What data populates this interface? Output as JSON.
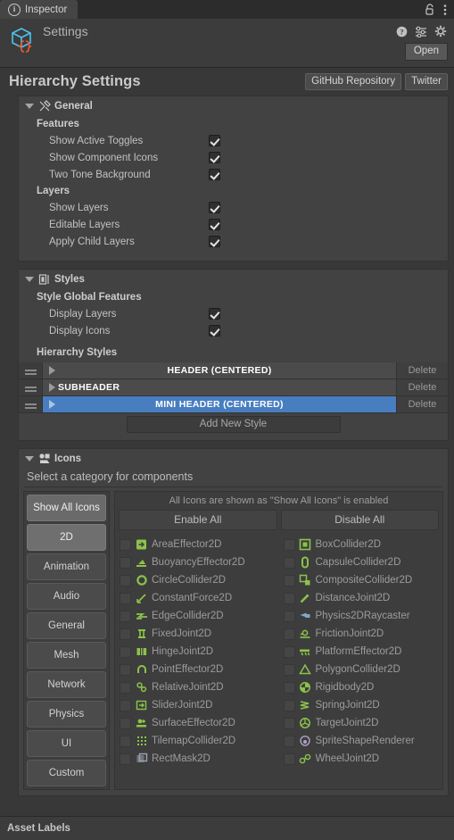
{
  "window": {
    "tab_label": "Inspector",
    "tab_icon": "info-icon",
    "lock_icon": "lock-open-icon",
    "menu_icon": "kebab-menu-icon"
  },
  "object_header": {
    "title": "Settings",
    "icon": "script-asset-cube-icon",
    "help_icon": "help-icon",
    "preset_icon": "preset-slider-icon",
    "settings_icon": "gear-icon",
    "open_button": "Open"
  },
  "page": {
    "title": "Hierarchy Settings",
    "links": [
      {
        "label": "GitHub Repository",
        "name": "github-repository-button"
      },
      {
        "label": "Twitter",
        "name": "twitter-button"
      }
    ]
  },
  "general": {
    "header": "General",
    "header_icon": "tools-icon",
    "groups": [
      {
        "label": "Features",
        "rows": [
          {
            "label": "Show Active Toggles",
            "checked": true
          },
          {
            "label": "Show Component Icons",
            "checked": true
          },
          {
            "label": "Two Tone Background",
            "checked": true
          }
        ]
      },
      {
        "label": "Layers",
        "rows": [
          {
            "label": "Show Layers",
            "checked": true
          },
          {
            "label": "Editable Layers",
            "checked": true
          },
          {
            "label": "Apply Child Layers",
            "checked": true
          }
        ]
      }
    ]
  },
  "styles": {
    "header": "Styles",
    "header_icon": "style-panel-icon",
    "group_label": "Style Global Features",
    "rows": [
      {
        "label": "Display Layers",
        "checked": true
      },
      {
        "label": "Display Icons",
        "checked": true
      }
    ],
    "list_label": "Hierarchy Styles",
    "items": [
      {
        "name": "HEADER (CENTERED)",
        "align": "center",
        "selected": false,
        "delete_label": "Delete"
      },
      {
        "name": "SUBHEADER",
        "align": "left",
        "selected": false,
        "delete_label": "Delete"
      },
      {
        "name": "MINI HEADER (CENTERED)",
        "align": "center",
        "selected": true,
        "delete_label": "Delete"
      }
    ],
    "add_button": "Add New Style"
  },
  "icons": {
    "header": "Icons",
    "header_icon": "components-icon",
    "subtitle": "Select a category for components",
    "categories": [
      {
        "label": "Show All Icons",
        "state": "toggled"
      },
      {
        "label": "2D",
        "state": "active"
      },
      {
        "label": "Animation",
        "state": "normal"
      },
      {
        "label": "Audio",
        "state": "normal"
      },
      {
        "label": "General",
        "state": "normal"
      },
      {
        "label": "Mesh",
        "state": "normal"
      },
      {
        "label": "Network",
        "state": "normal"
      },
      {
        "label": "Physics",
        "state": "normal"
      },
      {
        "label": "UI",
        "state": "normal"
      },
      {
        "label": "Custom",
        "state": "normal"
      }
    ],
    "notice": "All Icons are shown as \"Show All Icons\" is enabled",
    "enable_all": "Enable All",
    "disable_all": "Disable All",
    "left_column": [
      {
        "label": "AreaEffector2D",
        "checked": false,
        "glyph": "area-effector-2d-icon",
        "color": "#8bc34a"
      },
      {
        "label": "BuoyancyEffector2D",
        "checked": false,
        "glyph": "buoyancy-effector-2d-icon",
        "color": "#8bc34a"
      },
      {
        "label": "CircleCollider2D",
        "checked": false,
        "glyph": "circle-collider-2d-icon",
        "color": "#8bc34a"
      },
      {
        "label": "ConstantForce2D",
        "checked": false,
        "glyph": "constant-force-2d-icon",
        "color": "#8bc34a"
      },
      {
        "label": "EdgeCollider2D",
        "checked": false,
        "glyph": "edge-collider-2d-icon",
        "color": "#8bc34a"
      },
      {
        "label": "FixedJoint2D",
        "checked": false,
        "glyph": "fixed-joint-2d-icon",
        "color": "#8bc34a"
      },
      {
        "label": "HingeJoint2D",
        "checked": false,
        "glyph": "hinge-joint-2d-icon",
        "color": "#8bc34a"
      },
      {
        "label": "PointEffector2D",
        "checked": false,
        "glyph": "point-effector-2d-icon",
        "color": "#8bc34a"
      },
      {
        "label": "RelativeJoint2D",
        "checked": false,
        "glyph": "relative-joint-2d-icon",
        "color": "#8bc34a"
      },
      {
        "label": "SliderJoint2D",
        "checked": false,
        "glyph": "slider-joint-2d-icon",
        "color": "#8bc34a"
      },
      {
        "label": "SurfaceEffector2D",
        "checked": false,
        "glyph": "surface-effector-2d-icon",
        "color": "#8bc34a"
      },
      {
        "label": "TilemapCollider2D",
        "checked": false,
        "glyph": "tilemap-collider-2d-icon",
        "color": "#8bc34a"
      },
      {
        "label": "RectMask2D",
        "checked": false,
        "glyph": "rect-mask-2d-icon",
        "color": "#9aa4b0"
      }
    ],
    "right_column": [
      {
        "label": "BoxCollider2D",
        "checked": false,
        "glyph": "box-collider-2d-icon",
        "color": "#8bc34a"
      },
      {
        "label": "CapsuleCollider2D",
        "checked": false,
        "glyph": "capsule-collider-2d-icon",
        "color": "#8bc34a"
      },
      {
        "label": "CompositeCollider2D",
        "checked": false,
        "glyph": "composite-collider-2d-icon",
        "color": "#8bc34a"
      },
      {
        "label": "DistanceJoint2D",
        "checked": false,
        "glyph": "distance-joint-2d-icon",
        "color": "#8bc34a"
      },
      {
        "label": "Physics2DRaycaster",
        "checked": false,
        "glyph": "physics-2d-raycaster-icon",
        "color": "#7fa8cc"
      },
      {
        "label": "FrictionJoint2D",
        "checked": false,
        "glyph": "friction-joint-2d-icon",
        "color": "#8bc34a"
      },
      {
        "label": "PlatformEffector2D",
        "checked": false,
        "glyph": "platform-effector-2d-icon",
        "color": "#8bc34a"
      },
      {
        "label": "PolygonCollider2D",
        "checked": false,
        "glyph": "polygon-collider-2d-icon",
        "color": "#8bc34a"
      },
      {
        "label": "Rigidbody2D",
        "checked": false,
        "glyph": "rigidbody-2d-icon",
        "color": "#8bc34a"
      },
      {
        "label": "SpringJoint2D",
        "checked": false,
        "glyph": "spring-joint-2d-icon",
        "color": "#8bc34a"
      },
      {
        "label": "TargetJoint2D",
        "checked": false,
        "glyph": "target-joint-2d-icon",
        "color": "#8bc34a"
      },
      {
        "label": "SpriteShapeRenderer",
        "checked": false,
        "glyph": "sprite-shape-renderer-icon",
        "color": "#b0a0c8"
      },
      {
        "label": "WheelJoint2D",
        "checked": false,
        "glyph": "wheel-joint-2d-icon",
        "color": "#8bc34a"
      }
    ]
  },
  "footer": {
    "label": "Asset Labels"
  },
  "colors": {
    "selection_blue": "#487ec0",
    "panel_bg": "#383838",
    "box_bg": "#424242",
    "icon_green": "#8bc34a"
  }
}
